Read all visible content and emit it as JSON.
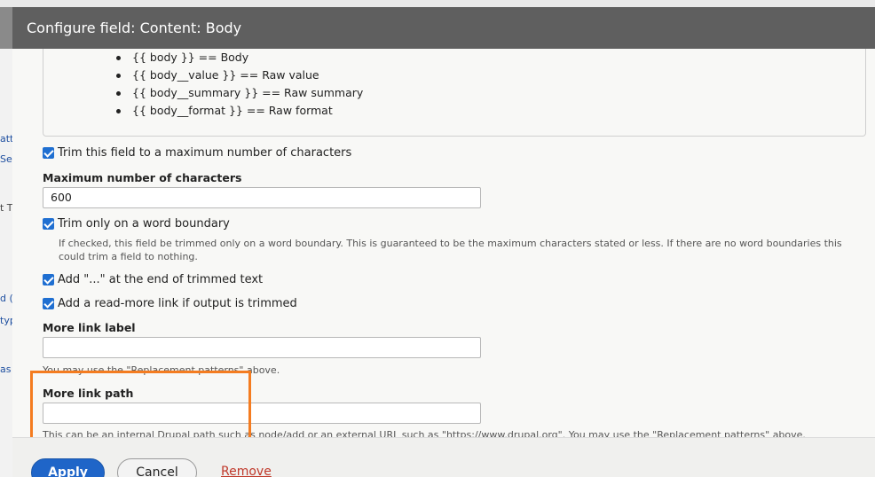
{
  "dialog": {
    "title": "Configure field: Content: Body"
  },
  "background": {
    "fragments": [
      "atte",
      "Se",
      "t T",
      "d (",
      "typ",
      "as"
    ]
  },
  "replacement_patterns": [
    "{{ body }} == Body",
    "{{ body__value }} == Raw value",
    "{{ body__summary }} == Raw summary",
    "{{ body__format }} == Raw format"
  ],
  "trim": {
    "checked": true,
    "label": "Trim this field to a maximum number of characters"
  },
  "max_chars": {
    "label": "Maximum number of characters",
    "value": "600"
  },
  "word_boundary": {
    "checked": true,
    "label": "Trim only on a word boundary",
    "description": "If checked, this field be trimmed only on a word boundary. This is guaranteed to be the maximum characters stated or less. If there are no word boundaries this could trim a field to nothing."
  },
  "ellipsis": {
    "checked": true,
    "label": "Add \"...\" at the end of trimmed text"
  },
  "read_more": {
    "checked": true,
    "label": "Add a read-more link if output is trimmed"
  },
  "more_link_label": {
    "label": "More link label",
    "value": "",
    "description": "You may use the \"Replacement patterns\" above."
  },
  "more_link_path": {
    "label": "More link path",
    "value": "",
    "description": "This can be an internal Drupal path such as node/add or an external URL such as \"https://www.drupal.org\". You may use the \"Replacement patterns\" above."
  },
  "footer": {
    "apply_label": "Apply",
    "cancel_label": "Cancel",
    "remove_label": "Remove"
  },
  "colors": {
    "primary": "#1f65c8",
    "highlight": "#f47c20",
    "checkbox": "#1f6fd1",
    "titlebar": "#5f5f5f",
    "remove_link": "#c0392b"
  }
}
